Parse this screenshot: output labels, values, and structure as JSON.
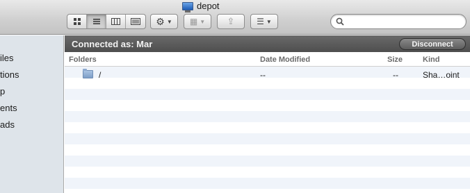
{
  "window": {
    "title": "depot"
  },
  "toolbar": {
    "view_icons": [
      "icon-view-icon",
      "list-view-icon",
      "column-view-icon",
      "coverflow-view-icon"
    ],
    "action_glyph": "⚙",
    "arrange_glyph": "▦",
    "share_glyph": "⇪",
    "group_glyph": "☰",
    "dropdown_glyph": "▼",
    "search": {
      "value": "",
      "placeholder": ""
    }
  },
  "sidebar": {
    "items": [
      {
        "label": "iles"
      },
      {
        "label": "tions"
      },
      {
        "label": "p"
      },
      {
        "label": "ents"
      },
      {
        "label": "ads"
      }
    ]
  },
  "banner": {
    "connected_label": "Connected as: Mar",
    "disconnect_label": "Disconnect"
  },
  "columns": {
    "folders": "Folders",
    "date_modified": "Date Modified",
    "size": "Size",
    "kind": "Kind"
  },
  "rows": [
    {
      "name": "/",
      "date_modified": "--",
      "size": "--",
      "kind": "Sha…oint"
    }
  ],
  "colors": {
    "banner_bg": "#575757",
    "sidebar_bg": "#dee4ea",
    "row_stripe": "#f0f4fa"
  }
}
